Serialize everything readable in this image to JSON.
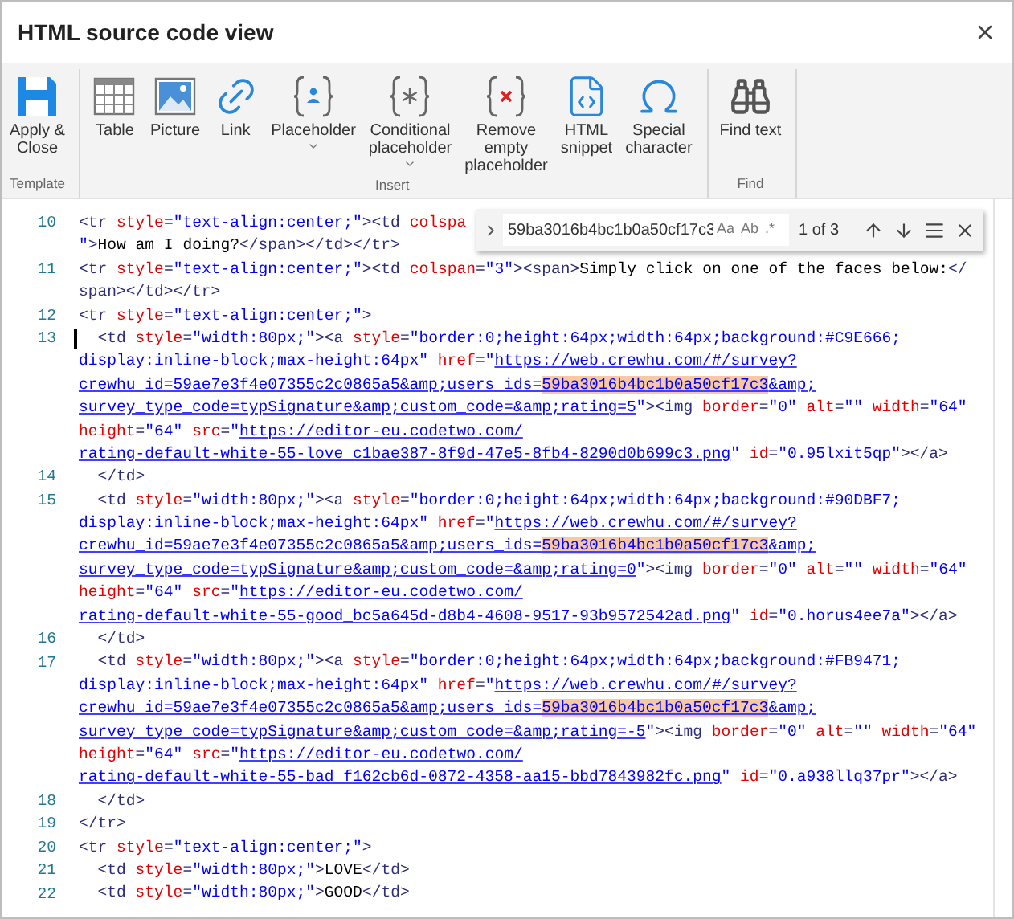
{
  "window": {
    "title": "HTML source code view"
  },
  "toolbar": {
    "groups": [
      {
        "label": "Template",
        "buttons": [
          {
            "kind": "save",
            "label": "Apply &\nClose",
            "dropdown": false
          }
        ]
      },
      {
        "label": "Insert",
        "buttons": [
          {
            "kind": "table",
            "label": "Table",
            "dropdown": false
          },
          {
            "kind": "picture",
            "label": "Picture",
            "dropdown": false
          },
          {
            "kind": "link",
            "label": "Link",
            "dropdown": false
          },
          {
            "kind": "placeholder",
            "label": "Placeholder",
            "dropdown": true
          },
          {
            "kind": "conditional",
            "label": "Conditional\nplaceholder",
            "dropdown": true
          },
          {
            "kind": "remove",
            "label": "Remove\nempty\nplaceholder",
            "dropdown": false
          },
          {
            "kind": "snippet",
            "label": "HTML\nsnippet",
            "dropdown": false
          },
          {
            "kind": "omega",
            "label": "Special\ncharacter",
            "dropdown": false
          }
        ]
      },
      {
        "label": "Find",
        "buttons": [
          {
            "kind": "find",
            "label": "Find text",
            "dropdown": false
          }
        ]
      }
    ]
  },
  "find_widget": {
    "query": "59ba3016b4bc1b0a50cf17c3",
    "options": [
      "Aa",
      "Ab",
      ".*"
    ],
    "count": "1 of 3"
  },
  "editor": {
    "lines": [
      {
        "number": "10",
        "cursor": false,
        "rows": [
          {
            "segments": [
              {
                "kind": "tag",
                "text": "<tr "
              },
              {
                "kind": "attr",
                "text": "style"
              },
              {
                "kind": "tag",
                "text": "="
              },
              {
                "kind": "string",
                "text": "\"text-align:center;\""
              },
              {
                "kind": "tag",
                "text": "><td "
              },
              {
                "kind": "attr",
                "text": "colspa"
              }
            ]
          },
          {
            "segments": [
              {
                "kind": "string",
                "text": "\""
              },
              {
                "kind": "tag",
                "text": ">"
              },
              {
                "kind": "text",
                "text": "How am I doing?"
              },
              {
                "kind": "tag",
                "text": "</span></td></tr>"
              }
            ]
          }
        ]
      },
      {
        "number": "11",
        "cursor": false,
        "rows": [
          {
            "segments": [
              {
                "kind": "tag",
                "text": "<tr "
              },
              {
                "kind": "attr",
                "text": "style"
              },
              {
                "kind": "tag",
                "text": "="
              },
              {
                "kind": "string",
                "text": "\"text-align:center;\""
              },
              {
                "kind": "tag",
                "text": "><td "
              },
              {
                "kind": "attr",
                "text": "colspan"
              },
              {
                "kind": "tag",
                "text": "="
              },
              {
                "kind": "string",
                "text": "\"3\""
              },
              {
                "kind": "tag",
                "text": "><span>"
              },
              {
                "kind": "text",
                "text": "Simply click on one of the faces below:"
              },
              {
                "kind": "tag",
                "text": "</"
              }
            ]
          },
          {
            "segments": [
              {
                "kind": "tag",
                "text": "span></td></tr>"
              }
            ]
          }
        ]
      },
      {
        "number": "12",
        "cursor": false,
        "rows": [
          {
            "segments": [
              {
                "kind": "tag",
                "text": "<tr "
              },
              {
                "kind": "attr",
                "text": "style"
              },
              {
                "kind": "tag",
                "text": "="
              },
              {
                "kind": "string",
                "text": "\"text-align:center;\""
              },
              {
                "kind": "tag",
                "text": ">"
              }
            ]
          }
        ]
      },
      {
        "number": "13",
        "cursor": true,
        "rows": [
          {
            "segments": [
              {
                "kind": "tag",
                "text": "  <td "
              },
              {
                "kind": "attr",
                "text": "style"
              },
              {
                "kind": "tag",
                "text": "="
              },
              {
                "kind": "string",
                "text": "\"width:80px;\""
              },
              {
                "kind": "tag",
                "text": "><a "
              },
              {
                "kind": "attr",
                "text": "style"
              },
              {
                "kind": "tag",
                "text": "="
              },
              {
                "kind": "string",
                "text": "\"border:0;height:64px;width:64px;background:#C9E666;"
              }
            ]
          },
          {
            "segments": [
              {
                "kind": "string",
                "text": "display:inline-block;max-height:64px\""
              },
              {
                "kind": "attr",
                "text": " href"
              },
              {
                "kind": "tag",
                "text": "="
              },
              {
                "kind": "string",
                "text": "\""
              },
              {
                "kind": "link",
                "text": "https://web.crewhu.com/#/survey?"
              }
            ]
          },
          {
            "segments": [
              {
                "kind": "link",
                "text": "crewhu_id=59ae7e3f4e07355c2c0865a5&amp;users_ids="
              },
              {
                "kind": "match",
                "text": "59ba3016b4bc1b0a50cf17c3"
              },
              {
                "kind": "link",
                "text": "&amp;"
              }
            ]
          },
          {
            "segments": [
              {
                "kind": "link",
                "text": "survey_type_code=typSignature&amp;custom_code=&amp;rating=5"
              },
              {
                "kind": "string",
                "text": "\""
              },
              {
                "kind": "tag",
                "text": "><img "
              },
              {
                "kind": "attr",
                "text": "border"
              },
              {
                "kind": "tag",
                "text": "="
              },
              {
                "kind": "string",
                "text": "\"0\""
              },
              {
                "kind": "attr",
                "text": " alt"
              },
              {
                "kind": "tag",
                "text": "="
              },
              {
                "kind": "string",
                "text": "\"\""
              },
              {
                "kind": "attr",
                "text": " width"
              },
              {
                "kind": "tag",
                "text": "="
              },
              {
                "kind": "string",
                "text": "\"64\""
              }
            ]
          },
          {
            "segments": [
              {
                "kind": "attr",
                "text": "height"
              },
              {
                "kind": "tag",
                "text": "="
              },
              {
                "kind": "string",
                "text": "\"64\""
              },
              {
                "kind": "attr",
                "text": " src"
              },
              {
                "kind": "tag",
                "text": "="
              },
              {
                "kind": "string",
                "text": "\""
              },
              {
                "kind": "link",
                "text": "https://editor-eu.codetwo.com/"
              }
            ]
          },
          {
            "segments": [
              {
                "kind": "link",
                "text": "rating-default-white-55-love_c1bae387-8f9d-47e5-8fb4-8290d0b699c3.png"
              },
              {
                "kind": "string",
                "text": "\""
              },
              {
                "kind": "attr",
                "text": " id"
              },
              {
                "kind": "tag",
                "text": "="
              },
              {
                "kind": "string",
                "text": "\"0.95lxit5qp\""
              },
              {
                "kind": "tag",
                "text": "></a>"
              }
            ]
          }
        ]
      },
      {
        "number": "14",
        "cursor": false,
        "rows": [
          {
            "segments": [
              {
                "kind": "tag",
                "text": "  </td>"
              }
            ]
          }
        ]
      },
      {
        "number": "15",
        "cursor": false,
        "rows": [
          {
            "segments": [
              {
                "kind": "tag",
                "text": "  <td "
              },
              {
                "kind": "attr",
                "text": "style"
              },
              {
                "kind": "tag",
                "text": "="
              },
              {
                "kind": "string",
                "text": "\"width:80px;\""
              },
              {
                "kind": "tag",
                "text": "><a "
              },
              {
                "kind": "attr",
                "text": "style"
              },
              {
                "kind": "tag",
                "text": "="
              },
              {
                "kind": "string",
                "text": "\"border:0;height:64px;width:64px;background:#90DBF7;"
              }
            ]
          },
          {
            "segments": [
              {
                "kind": "string",
                "text": "display:inline-block;max-height:64px\""
              },
              {
                "kind": "attr",
                "text": " href"
              },
              {
                "kind": "tag",
                "text": "="
              },
              {
                "kind": "string",
                "text": "\""
              },
              {
                "kind": "link",
                "text": "https://web.crewhu.com/#/survey?"
              }
            ]
          },
          {
            "segments": [
              {
                "kind": "link",
                "text": "crewhu_id=59ae7e3f4e07355c2c0865a5&amp;users_ids="
              },
              {
                "kind": "match",
                "text": "59ba3016b4bc1b0a50cf17c3"
              },
              {
                "kind": "link",
                "text": "&amp;"
              }
            ]
          },
          {
            "segments": [
              {
                "kind": "link",
                "text": "survey_type_code=typSignature&amp;custom_code=&amp;rating=0"
              },
              {
                "kind": "string",
                "text": "\""
              },
              {
                "kind": "tag",
                "text": "><img "
              },
              {
                "kind": "attr",
                "text": "border"
              },
              {
                "kind": "tag",
                "text": "="
              },
              {
                "kind": "string",
                "text": "\"0\""
              },
              {
                "kind": "attr",
                "text": " alt"
              },
              {
                "kind": "tag",
                "text": "="
              },
              {
                "kind": "string",
                "text": "\"\""
              },
              {
                "kind": "attr",
                "text": " width"
              },
              {
                "kind": "tag",
                "text": "="
              },
              {
                "kind": "string",
                "text": "\"64\""
              }
            ]
          },
          {
            "segments": [
              {
                "kind": "attr",
                "text": "height"
              },
              {
                "kind": "tag",
                "text": "="
              },
              {
                "kind": "string",
                "text": "\"64\""
              },
              {
                "kind": "attr",
                "text": " src"
              },
              {
                "kind": "tag",
                "text": "="
              },
              {
                "kind": "string",
                "text": "\""
              },
              {
                "kind": "link",
                "text": "https://editor-eu.codetwo.com/"
              }
            ]
          },
          {
            "segments": [
              {
                "kind": "link",
                "text": "rating-default-white-55-good_bc5a645d-d8b4-4608-9517-93b9572542ad.png"
              },
              {
                "kind": "string",
                "text": "\""
              },
              {
                "kind": "attr",
                "text": " id"
              },
              {
                "kind": "tag",
                "text": "="
              },
              {
                "kind": "string",
                "text": "\"0.horus4ee7a\""
              },
              {
                "kind": "tag",
                "text": "></a>"
              }
            ]
          }
        ]
      },
      {
        "number": "16",
        "cursor": false,
        "rows": [
          {
            "segments": [
              {
                "kind": "tag",
                "text": "  </td>"
              }
            ]
          }
        ]
      },
      {
        "number": "17",
        "cursor": false,
        "rows": [
          {
            "segments": [
              {
                "kind": "tag",
                "text": "  <td "
              },
              {
                "kind": "attr",
                "text": "style"
              },
              {
                "kind": "tag",
                "text": "="
              },
              {
                "kind": "string",
                "text": "\"width:80px;\""
              },
              {
                "kind": "tag",
                "text": "><a "
              },
              {
                "kind": "attr",
                "text": "style"
              },
              {
                "kind": "tag",
                "text": "="
              },
              {
                "kind": "string",
                "text": "\"border:0;height:64px;width:64px;background:#FB9471;"
              }
            ]
          },
          {
            "segments": [
              {
                "kind": "string",
                "text": "display:inline-block;max-height:64px\""
              },
              {
                "kind": "attr",
                "text": " href"
              },
              {
                "kind": "tag",
                "text": "="
              },
              {
                "kind": "string",
                "text": "\""
              },
              {
                "kind": "link",
                "text": "https://web.crewhu.com/#/survey?"
              }
            ]
          },
          {
            "segments": [
              {
                "kind": "link",
                "text": "crewhu_id=59ae7e3f4e07355c2c0865a5&amp;users_ids="
              },
              {
                "kind": "match",
                "text": "59ba3016b4bc1b0a50cf17c3"
              },
              {
                "kind": "link",
                "text": "&amp;"
              }
            ]
          },
          {
            "segments": [
              {
                "kind": "link",
                "text": "survey_type_code=typSignature&amp;custom_code=&amp;rating=-5"
              },
              {
                "kind": "string",
                "text": "\""
              },
              {
                "kind": "tag",
                "text": "><img "
              },
              {
                "kind": "attr",
                "text": "border"
              },
              {
                "kind": "tag",
                "text": "="
              },
              {
                "kind": "string",
                "text": "\"0\""
              },
              {
                "kind": "attr",
                "text": " alt"
              },
              {
                "kind": "tag",
                "text": "="
              },
              {
                "kind": "string",
                "text": "\"\""
              },
              {
                "kind": "attr",
                "text": " width"
              },
              {
                "kind": "tag",
                "text": "="
              },
              {
                "kind": "string",
                "text": "\"64\""
              }
            ]
          },
          {
            "segments": [
              {
                "kind": "attr",
                "text": "height"
              },
              {
                "kind": "tag",
                "text": "="
              },
              {
                "kind": "string",
                "text": "\"64\""
              },
              {
                "kind": "attr",
                "text": " src"
              },
              {
                "kind": "tag",
                "text": "="
              },
              {
                "kind": "string",
                "text": "\""
              },
              {
                "kind": "link",
                "text": "https://editor-eu.codetwo.com/"
              }
            ]
          },
          {
            "segments": [
              {
                "kind": "link",
                "text": "rating-default-white-55-bad_f162cb6d-0872-4358-aa15-bbd7843982fc.png"
              },
              {
                "kind": "string",
                "text": "\""
              },
              {
                "kind": "attr",
                "text": " id"
              },
              {
                "kind": "tag",
                "text": "="
              },
              {
                "kind": "string",
                "text": "\"0.a938llq37pr\""
              },
              {
                "kind": "tag",
                "text": "></a>"
              }
            ]
          }
        ]
      },
      {
        "number": "18",
        "cursor": false,
        "rows": [
          {
            "segments": [
              {
                "kind": "tag",
                "text": "  </td>"
              }
            ]
          }
        ]
      },
      {
        "number": "19",
        "cursor": false,
        "rows": [
          {
            "segments": [
              {
                "kind": "tag",
                "text": "</tr>"
              }
            ]
          }
        ]
      },
      {
        "number": "20",
        "cursor": false,
        "rows": [
          {
            "segments": [
              {
                "kind": "tag",
                "text": "<tr "
              },
              {
                "kind": "attr",
                "text": "style"
              },
              {
                "kind": "tag",
                "text": "="
              },
              {
                "kind": "string",
                "text": "\"text-align:center;\""
              },
              {
                "kind": "tag",
                "text": ">"
              }
            ]
          }
        ]
      },
      {
        "number": "21",
        "cursor": false,
        "rows": [
          {
            "segments": [
              {
                "kind": "tag",
                "text": "  <td "
              },
              {
                "kind": "attr",
                "text": "style"
              },
              {
                "kind": "tag",
                "text": "="
              },
              {
                "kind": "string",
                "text": "\"width:80px;\""
              },
              {
                "kind": "tag",
                "text": ">"
              },
              {
                "kind": "text",
                "text": "LOVE"
              },
              {
                "kind": "tag",
                "text": "</td>"
              }
            ]
          }
        ]
      },
      {
        "number": "22",
        "cursor": false,
        "rows": [
          {
            "segments": [
              {
                "kind": "tag",
                "text": "  <td "
              },
              {
                "kind": "attr",
                "text": "style"
              },
              {
                "kind": "tag",
                "text": "="
              },
              {
                "kind": "string",
                "text": "\"width:80px;\""
              },
              {
                "kind": "tag",
                "text": ">"
              },
              {
                "kind": "text",
                "text": "GOOD"
              },
              {
                "kind": "tag",
                "text": "</td>"
              }
            ]
          }
        ]
      }
    ]
  }
}
